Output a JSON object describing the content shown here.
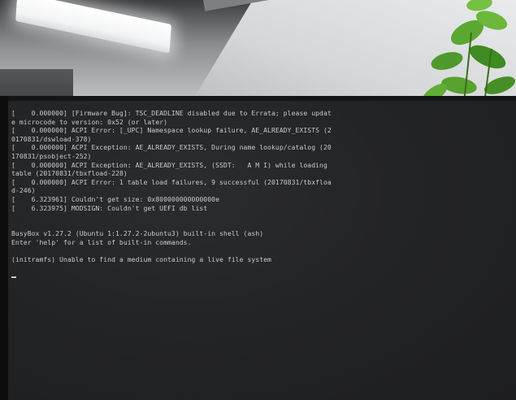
{
  "console": {
    "lines": [
      "[    0.000000] [Firmware Bug]: TSC_DEADLINE disabled due to Errata; please updat",
      "e microcode to version: 0x52 (or later)",
      "[    0.000000] ACPI Error: [_UPC] Namespace lookup failure, AE_ALREADY_EXISTS (2",
      "0170831/dswload-378)",
      "[    0.000000] ACPI Exception: AE_ALREADY_EXISTS, During name lookup/catalog (20",
      "170831/psobject-252)",
      "[    0.000000] ACPI Exception: AE_ALREADY_EXISTS, (SSDT:   A M I) while loading",
      "table (20170831/tbxfload-228)",
      "[    0.000000] ACPI Error: 1 table load failures, 9 successful (20170831/tbxfloa",
      "d-246)",
      "[    6.323961] Couldn't get size: 0x800000000000000e",
      "[    6.323975] MODSIGN: Couldn't get UEFI db list",
      "",
      "",
      "BusyBox v1.27.2 (Ubuntu 1:1.27.2-2ubuntu3) built-in shell (ash)",
      "Enter 'help' for a list of built-in commands.",
      "",
      "(initramfs) Unable to find a medium containing a live file system"
    ]
  },
  "colors": {
    "screen_background": "#232426",
    "console_text": "#c9cbc8",
    "bezel": "#0c0c0d",
    "plant_leaf": "#4f9a2c"
  }
}
